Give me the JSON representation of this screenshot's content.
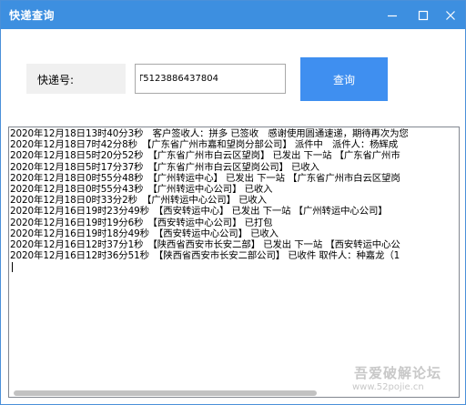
{
  "window": {
    "title": "快递查询"
  },
  "form": {
    "label": "快递号:",
    "tracking_value": "YT5123886437804",
    "query_label": "查询"
  },
  "results": [
    "2020年12月18日13时40分3秒　客户签收人：拼多 已签收　感谢使用圆通速递，期待再次为您",
    "2020年12月18日7时42分8秒　【广东省广州市嘉和望岗分部公司】 派件中　派件人：杨辉成",
    "2020年12月18日5时20分52秒　【广东省广州市白云区望岗】 已发出 下一站 【广东省广州市",
    "2020年12月18日5时17分37秒　【广东省广州市白云区望岗公司】 已收入",
    "2020年12月18日0时55分48秒　【广州转运中心】 已发出 下一站 【广东省广州市白云区望岗",
    "2020年12月18日0时55分43秒　【广州转运中心公司】 已收入",
    "2020年12月18日0时33分2秒　【广州转运中心公司】 已收入",
    "2020年12月16日19时23分49秒　【西安转运中心】 已发出 下一站 【广州转运中心公司】",
    "2020年12月16日19时19分6秒　【西安转运中心公司】 已打包",
    "2020年12月16日19时18分49秒　【西安转运中心公司】 已收入",
    "2020年12月16日12时37分1秒　【陕西省西安市长安二部】 已发出 下一站 【西安转运中心公",
    "2020年12月16日12时36分51秒　【陕西省西安市长安二部公司】 已收件 取件人：种嘉龙（1"
  ],
  "watermark": {
    "text": "吾爱破解论坛",
    "url": "www.52pojie.cn"
  },
  "colors": {
    "titlebar": "#3d8fe0",
    "button": "#3f8ff0"
  },
  "icons": {
    "minimize": "minimize-icon",
    "maximize": "maximize-icon",
    "close": "close-icon"
  }
}
